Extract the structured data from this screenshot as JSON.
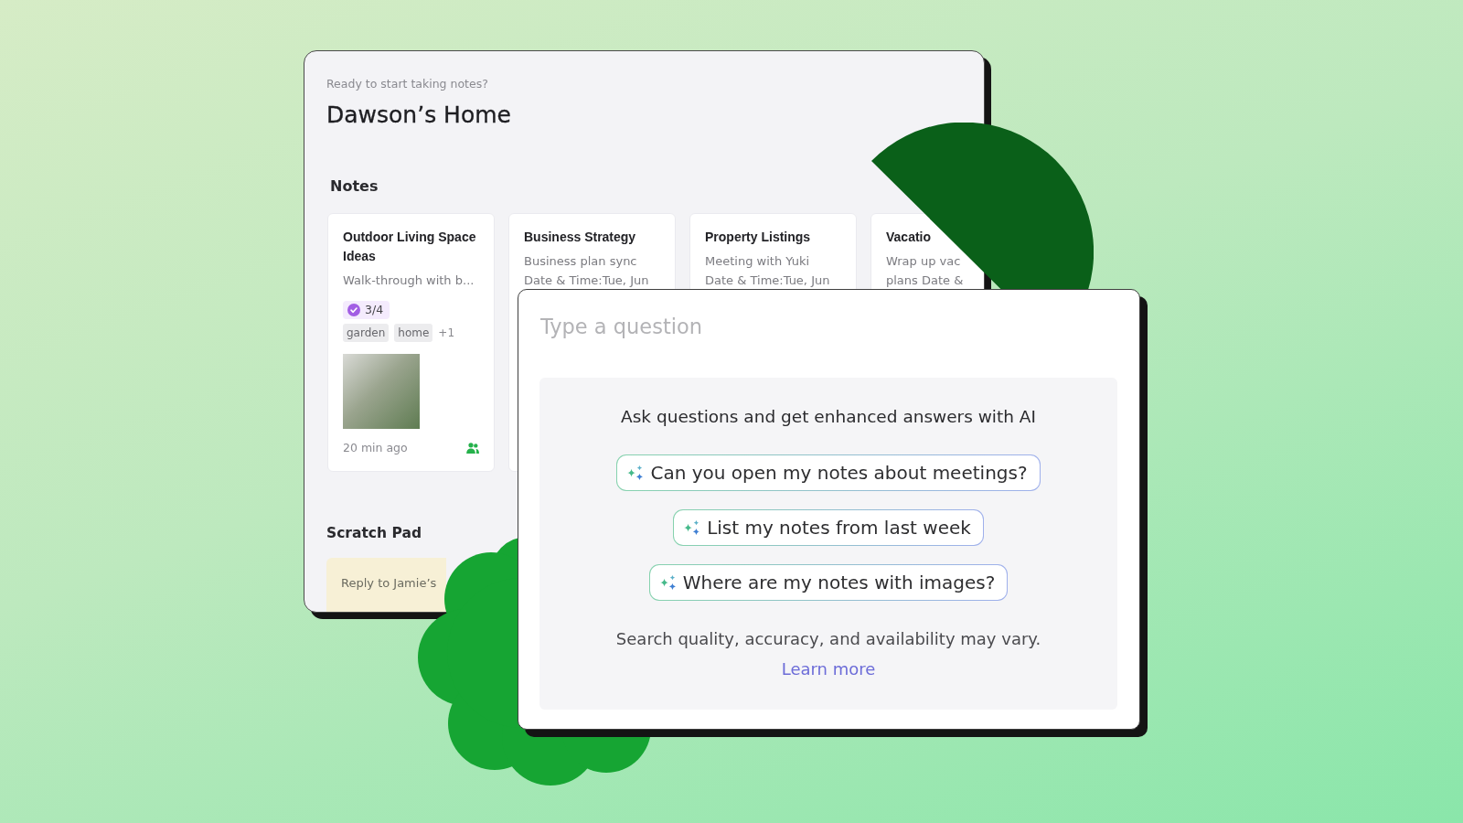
{
  "notes_window": {
    "subtitle": "Ready to start taking notes?",
    "title": "Dawson’s Home",
    "notes": {
      "heading": "Notes",
      "cards": [
        {
          "kind": "detailed",
          "title": "Outdoor Living Space Ideas",
          "lines": [
            "Walk-through with b..."
          ],
          "checklist": "3/4",
          "tags": [
            "garden",
            "home"
          ],
          "more_tags": "+1",
          "time": "20 min ago"
        },
        {
          "kind": "preview",
          "title": "Business Strategy",
          "lines": [
            "Business plan sync",
            "Date & Time:Tue, Jun"
          ]
        },
        {
          "kind": "preview",
          "title": "Property Listings",
          "lines": [
            "Meeting with Yuki",
            "Date & Time:Tue, Jun"
          ]
        },
        {
          "kind": "preview",
          "title": "Vacatio",
          "lines": [
            "Wrap up vac",
            "plans Date &"
          ]
        }
      ]
    },
    "scratch_pad": {
      "heading": "Scratch Pad",
      "note": "Reply to Jamie’s"
    }
  },
  "ask_panel": {
    "placeholder": "Type a question",
    "intro": "Ask questions and get enhanced answers with AI",
    "suggestions": [
      "Can you open my notes about meetings?",
      "List my notes from last week",
      "Where are my notes with images?"
    ],
    "disclaimer": "Search quality, accuracy, and availability may vary.",
    "link": "Learn more"
  }
}
